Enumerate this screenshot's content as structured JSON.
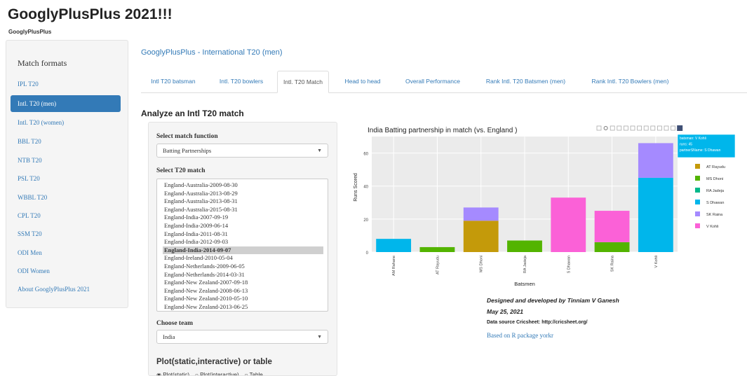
{
  "app": {
    "title": "GooglyPlusPlus 2021!!!",
    "subtitle": "GooglyPlusPlus"
  },
  "sidebar": {
    "heading": "Match formats",
    "active_index": 1,
    "items": [
      "IPL T20",
      "Intl. T20 (men)",
      "Intl. T20 (women)",
      "BBL T20",
      "NTB T20",
      "PSL T20",
      "WBBL T20",
      "CPL T20",
      "SSM T20",
      "ODI Men",
      "ODI Women",
      "About GooglyPlusPlus 2021"
    ]
  },
  "main": {
    "title": "GooglyPlusPlus - International T20 (men)",
    "active_tab": 2,
    "tabs": [
      "Intl T20 batsman",
      "Intl. T20 bowlers",
      "Intl. T20 Match",
      "Head to head",
      "Overall Performance",
      "Rank Intl. T20 Batsmen (men)",
      "Rank Intl. T20 Bowlers (men)"
    ],
    "panel_heading": "Analyze an Intl T20 match"
  },
  "controls": {
    "function_label": "Select match function",
    "function_value": "Batting Partnerships",
    "match_label": "Select T20 match",
    "matches": [
      "England-Australia-2009-08-30",
      "England-Australia-2013-08-29",
      "England-Australia-2013-08-31",
      "England-Australia-2015-08-31",
      "England-India-2007-09-19",
      "England-India-2009-06-14",
      "England-India-2011-08-31",
      "England-India-2012-09-03",
      "England-India-2014-09-07",
      "England-Ireland-2010-05-04",
      "England-Netherlands-2009-06-05",
      "England-Netherlands-2014-03-31",
      "England-New Zealand-2007-09-18",
      "England-New Zealand-2008-06-13",
      "England-New Zealand-2010-05-10",
      "England-New Zealand-2013-06-25"
    ],
    "selected_match_index": 8,
    "team_label": "Choose team",
    "team_value": "India",
    "plot_type_label": "Plot(static,interactive) or table",
    "radio_options": [
      "Plot(static)",
      "Plot(interactive)",
      "Table"
    ]
  },
  "chart_data": {
    "type": "bar",
    "stacked": true,
    "title": "India Batting partnership in match (vs. England )",
    "xlabel": "Batsmen",
    "ylabel": "Runs Scored",
    "ylim": [
      0,
      70
    ],
    "yticks": [
      0,
      20,
      40,
      60
    ],
    "legend_placement": "right",
    "categories": [
      "AM Rahane",
      "AT Rayudu",
      "MS Dhoni",
      "RA Jadeja",
      "S Dhawan",
      "SK Raina",
      "V Kohli"
    ],
    "series": [
      {
        "name": "AT Rayudu",
        "color": "#c49a0a",
        "values": [
          0,
          0,
          19,
          0,
          0,
          0,
          0
        ]
      },
      {
        "name": "MS Dhoni",
        "color": "#53b400",
        "values": [
          0,
          3,
          0,
          7,
          0,
          6,
          0
        ]
      },
      {
        "name": "RA Jadeja",
        "color": "#00b88a",
        "values": [
          0,
          0,
          0,
          0,
          0,
          0,
          0
        ]
      },
      {
        "name": "S Dhawan",
        "color": "#00b6eb",
        "values": [
          8,
          0,
          0,
          0,
          0,
          0,
          45
        ]
      },
      {
        "name": "SK Raina",
        "color": "#a58aff",
        "values": [
          0,
          0,
          8,
          0,
          0,
          0,
          21
        ]
      },
      {
        "name": "V Kohli",
        "color": "#fb61d7",
        "values": [
          0,
          0,
          0,
          0,
          33,
          19,
          0
        ]
      }
    ],
    "tooltip": [
      "batsman: V Kohli",
      "runs: 45",
      "partnerSName: S Dhawan"
    ],
    "colors": {
      "panel_bg": "#ebebeb",
      "grid": "#ffffff"
    }
  },
  "credits": {
    "line1": "Designed and developed by Tinniam V Ganesh",
    "line2": "May 25, 2021",
    "line3": "Data source Cricsheet: http://cricsheet.org/",
    "line4": "Based on R package yorkr"
  },
  "icons": {
    "select_caret": "▼",
    "toolbar": [
      "camera-icon",
      "zoom-icon",
      "pan-icon",
      "box-select-icon",
      "lasso-icon",
      "zoom-in-icon",
      "zoom-out-icon",
      "autoscale-icon",
      "reset-axes-icon",
      "spike-lines-icon",
      "hover-closest-icon",
      "hover-compare-icon",
      "plotly-logo-icon"
    ]
  }
}
